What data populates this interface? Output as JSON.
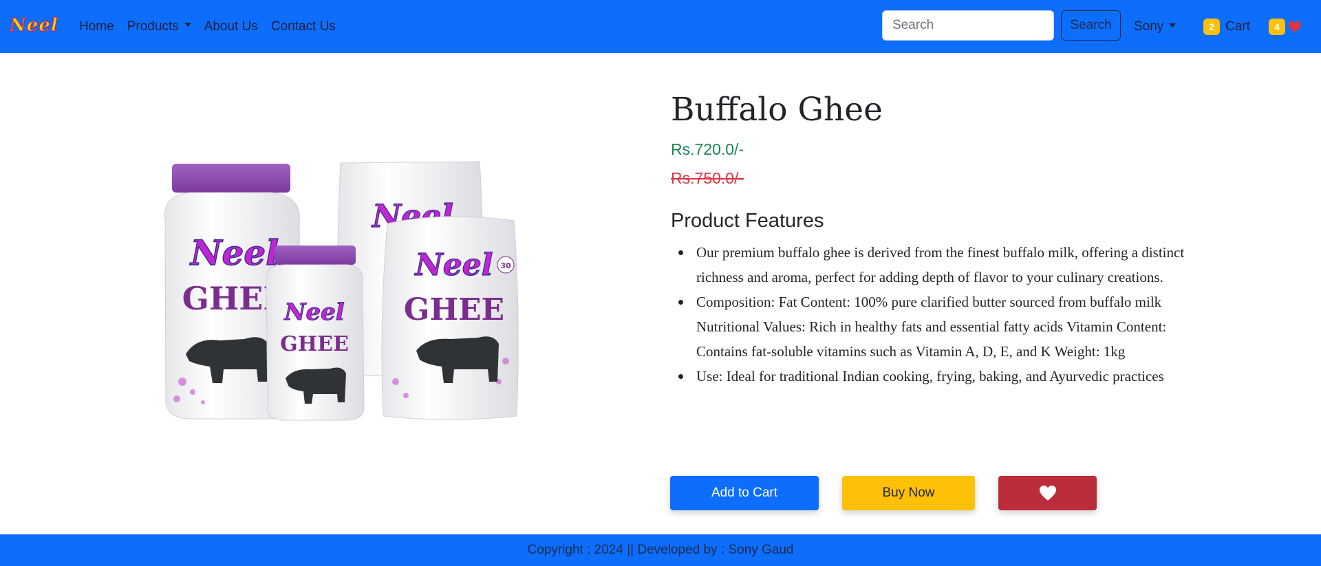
{
  "brand": {
    "logo_text": "Neel"
  },
  "nav": {
    "items": [
      {
        "label": "Home",
        "has_dropdown": false
      },
      {
        "label": "Products",
        "has_dropdown": true
      },
      {
        "label": "About Us",
        "has_dropdown": false
      },
      {
        "label": "Contact Us",
        "has_dropdown": false
      }
    ]
  },
  "search": {
    "placeholder": "Search",
    "value": "",
    "button_label": "Search"
  },
  "user": {
    "name": "Sony"
  },
  "cart": {
    "count": "2",
    "label": "Cart"
  },
  "wishlist": {
    "count": "4",
    "icon": "heart-icon"
  },
  "product": {
    "title": "Buffalo Ghee",
    "price": "Rs.720.0/-",
    "old_price": "Rs.750.0/-",
    "features_heading": "Product Features",
    "features": [
      "Our premium buffalo ghee is derived from the finest buffalo milk, offering a distinct richness and aroma, perfect for adding depth of flavor to your culinary creations.",
      "Composition: Fat Content: 100% pure clarified butter sourced from buffalo milk Nutritional Values: Rich in healthy fats and essential fatty acids Vitamin Content: Contains fat-soluble vitamins such as Vitamin A, D, E, and K Weight: 1kg",
      "Use: Ideal for traditional Indian cooking, frying, baking, and Ayurvedic practices"
    ],
    "image": {
      "brand_text": "Neel",
      "product_text": "GHEE",
      "badge_text": "30"
    }
  },
  "actions": {
    "add_to_cart": "Add to Cart",
    "buy_now": "Buy Now",
    "wishlist_icon": "heart-icon"
  },
  "footer": {
    "text": "Copyright : 2024 || Developed by : Sony Gaud"
  },
  "colors": {
    "primary": "#0d6efd",
    "price_green": "#198754",
    "old_price_red": "#dc3545",
    "warning": "#ffc107",
    "danger": "#bb2d3b"
  }
}
